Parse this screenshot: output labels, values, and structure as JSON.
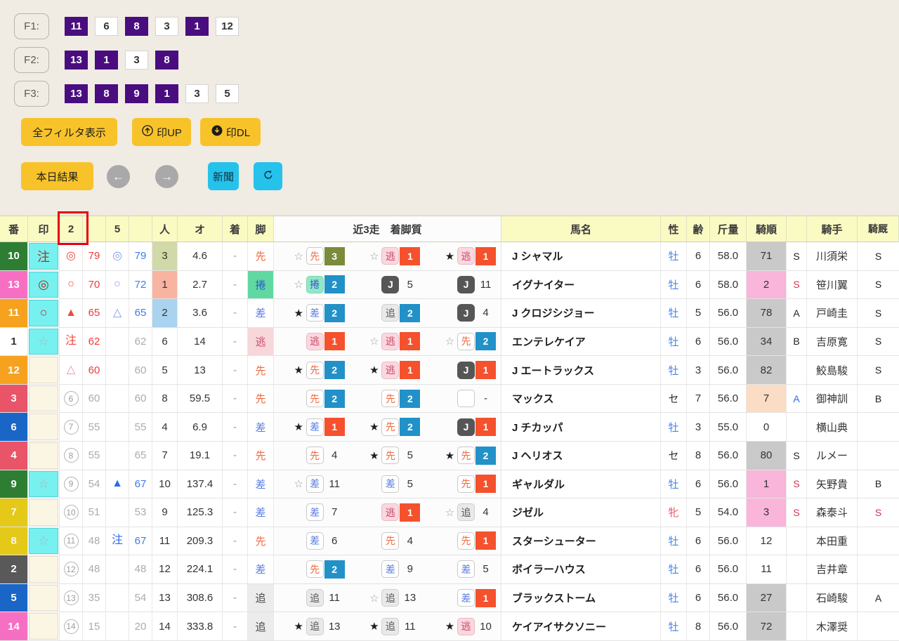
{
  "filters": {
    "rows": [
      {
        "label": "F1:",
        "chips": [
          {
            "v": "11",
            "on": true
          },
          {
            "v": "6",
            "on": false
          },
          {
            "v": "8",
            "on": true
          },
          {
            "v": "3",
            "on": false
          },
          {
            "v": "1",
            "on": true
          },
          {
            "v": "12",
            "on": false
          }
        ]
      },
      {
        "label": "F2:",
        "chips": [
          {
            "v": "13",
            "on": true
          },
          {
            "v": "1",
            "on": true
          },
          {
            "v": "3",
            "on": false
          },
          {
            "v": "8",
            "on": true
          }
        ]
      },
      {
        "label": "F3:",
        "chips": [
          {
            "v": "13",
            "on": true
          },
          {
            "v": "8",
            "on": true
          },
          {
            "v": "9",
            "on": true
          },
          {
            "v": "1",
            "on": true
          },
          {
            "v": "3",
            "on": false
          },
          {
            "v": "5",
            "on": false
          }
        ]
      }
    ]
  },
  "buttons": {
    "show_all_filters": "全フィルタ表示",
    "mark_up": "印UP",
    "mark_dl": "印DL",
    "today_results": "本日結果",
    "prev_arrow": "←",
    "next_arrow": "→",
    "newspaper": "新聞"
  },
  "icons": [
    "upload-icon",
    "download-icon",
    "left-arrow-icon",
    "right-arrow-icon",
    "refresh-icon"
  ],
  "colors": {
    "page_bg": "#f0ebe3",
    "chip_selected": "#490d80",
    "button_yellow": "#f8c32a",
    "button_cyan": "#25c2ec",
    "header_bg": "#fafac3",
    "annotation_red": "#e60012",
    "pos1": "#f4512c",
    "pos2": "#2191c8",
    "pos3": "#7a8b3a"
  },
  "annotation": {
    "target_header": "2",
    "color": "#e60012"
  },
  "table": {
    "headers": [
      "番",
      "印",
      "2",
      "",
      "5",
      "",
      "人",
      "オ",
      "着",
      "脚",
      "近3走　着脚質",
      "馬名",
      "性",
      "齢",
      "斤量",
      "騎順",
      "",
      "騎手",
      "騎厩"
    ],
    "rows": [
      {
        "num": "10",
        "waku": "w6",
        "mark": "注",
        "mark_cls": "mk-dr",
        "m1": "◎",
        "m1_cls": "sym-r",
        "m1_circ": false,
        "s1": "79",
        "s1_cls": "sc-r",
        "m2": "◎",
        "m2_cls": "sym-bl",
        "s2": "79",
        "s2_cls": "sc-b",
        "pop": "3",
        "pop_bg": "p3bg",
        "odds": "4.6",
        "fin": "-",
        "leg": "先",
        "leg_cls": "leg-sen",
        "runs": [
          {
            "star": "☆",
            "chip": "先",
            "chip_cls": "rc-sen",
            "pos": "3",
            "pos_cls": "pos-p3"
          },
          {
            "star": "☆",
            "chip": "逃",
            "chip_cls": "rc-nige",
            "pos": "1",
            "pos_cls": "pos-p1"
          },
          {
            "star": "★",
            "chip": "逃",
            "chip_cls": "rc-nige",
            "pos": "1",
            "pos_cls": "pos-p1"
          }
        ],
        "name": "J シャマル",
        "sex": "牡",
        "sex_cls": "sx-m",
        "age": "6",
        "wt": "58.0",
        "ord": "71",
        "ord_bg": "ord-gray",
        "sab": "S",
        "sab_cls": "t-k",
        "jockey": "川須栄",
        "kk": "S",
        "kk_cls": "t-k"
      },
      {
        "num": "13",
        "waku": "w8",
        "mark": "◎",
        "mark_cls": "mk-dr",
        "m1": "○",
        "m1_cls": "sym-r",
        "m1_circ": false,
        "s1": "70",
        "s1_cls": "sc-r",
        "m2": "○",
        "m2_cls": "sym-bl",
        "s2": "72",
        "s2_cls": "sc-b",
        "pop": "1",
        "pop_bg": "p1bg",
        "odds": "2.7",
        "fin": "-",
        "leg": "捲",
        "leg_cls": "leg-makuri",
        "runs": [
          {
            "star": "☆",
            "chip": "捲",
            "chip_cls": "rc-makuri",
            "pos": "2",
            "pos_cls": "pos-p2"
          },
          {
            "star": "",
            "chip": "J",
            "chip_cls": "rc-J",
            "pos": "5",
            "pos_cls": "pos-pn"
          },
          {
            "star": "",
            "chip": "J",
            "chip_cls": "rc-J",
            "pos": "11",
            "pos_cls": "pos-pn"
          }
        ],
        "name": "イグナイター",
        "sex": "牡",
        "sex_cls": "sx-m",
        "age": "6",
        "wt": "58.0",
        "ord": "2",
        "ord_bg": "ord-pink",
        "sab": "S",
        "sab_cls": "t-r",
        "jockey": "笹川翼",
        "kk": "S",
        "kk_cls": "t-k"
      },
      {
        "num": "11",
        "waku": "w7",
        "mark": "○",
        "mark_cls": "mk-dr",
        "m1": "▲",
        "m1_cls": "sym-r",
        "m1_circ": false,
        "s1": "65",
        "s1_cls": "sc-r",
        "m2": "△",
        "m2_cls": "sym-bl",
        "s2": "65",
        "s2_cls": "sc-b",
        "pop": "2",
        "pop_bg": "p2bg",
        "odds": "3.6",
        "fin": "-",
        "leg": "差",
        "leg_cls": "leg-sashi",
        "runs": [
          {
            "star": "★",
            "chip": "差",
            "chip_cls": "rc-sashi",
            "pos": "2",
            "pos_cls": "pos-p2"
          },
          {
            "star": "",
            "chip": "追",
            "chip_cls": "rc-oi",
            "pos": "2",
            "pos_cls": "pos-p2"
          },
          {
            "star": "",
            "chip": "J",
            "chip_cls": "rc-J",
            "pos": "4",
            "pos_cls": "pos-pn"
          }
        ],
        "name": "J クロジシジョー",
        "sex": "牡",
        "sex_cls": "sx-m",
        "age": "5",
        "wt": "56.0",
        "ord": "78",
        "ord_bg": "ord-gray",
        "sab": "A",
        "sab_cls": "t-k",
        "jockey": "戸崎圭",
        "kk": "S",
        "kk_cls": "t-k"
      },
      {
        "num": "1",
        "waku": "w1",
        "mark": "☆",
        "mark_cls": "mk-gs",
        "m1": "注",
        "m1_cls": "sym-r",
        "m1_circ": false,
        "s1": "62",
        "s1_cls": "sc-r",
        "m2": "",
        "m2_cls": "",
        "s2": "62",
        "s2_cls": "sc-g",
        "pop": "6",
        "pop_bg": "",
        "odds": "14",
        "fin": "-",
        "leg": "逃",
        "leg_cls": "leg-nige",
        "runs": [
          {
            "star": "",
            "chip": "逃",
            "chip_cls": "rc-nige",
            "pos": "1",
            "pos_cls": "pos-p1"
          },
          {
            "star": "☆",
            "chip": "逃",
            "chip_cls": "rc-nige",
            "pos": "1",
            "pos_cls": "pos-p1"
          },
          {
            "star": "☆",
            "chip": "先",
            "chip_cls": "rc-sen",
            "pos": "2",
            "pos_cls": "pos-p2"
          }
        ],
        "name": "エンテレケイア",
        "sex": "牡",
        "sex_cls": "sx-m",
        "age": "6",
        "wt": "56.0",
        "ord": "34",
        "ord_bg": "ord-gray",
        "sab": "B",
        "sab_cls": "t-k",
        "jockey": "吉原寛",
        "kk": "S",
        "kk_cls": "t-k"
      },
      {
        "num": "12",
        "waku": "w7",
        "mark": "",
        "mark_cls": "",
        "m1": "△",
        "m1_cls": "sym-pk",
        "m1_circ": false,
        "s1": "60",
        "s1_cls": "sc-r",
        "m2": "",
        "m2_cls": "",
        "s2": "60",
        "s2_cls": "sc-g",
        "pop": "5",
        "pop_bg": "",
        "odds": "13",
        "fin": "-",
        "leg": "先",
        "leg_cls": "leg-sen",
        "runs": [
          {
            "star": "★",
            "chip": "先",
            "chip_cls": "rc-sen",
            "pos": "2",
            "pos_cls": "pos-p2"
          },
          {
            "star": "★",
            "chip": "逃",
            "chip_cls": "rc-nige",
            "pos": "1",
            "pos_cls": "pos-p1"
          },
          {
            "star": "",
            "chip": "J",
            "chip_cls": "rc-J",
            "pos": "1",
            "pos_cls": "pos-p1"
          }
        ],
        "name": "J エートラックス",
        "sex": "牡",
        "sex_cls": "sx-m",
        "age": "3",
        "wt": "56.0",
        "ord": "82",
        "ord_bg": "ord-gray",
        "sab": "",
        "sab_cls": "",
        "jockey": "鮫島駿",
        "kk": "S",
        "kk_cls": "t-k"
      },
      {
        "num": "3",
        "waku": "w3",
        "mark": "",
        "mark_cls": "",
        "m1": "6",
        "m1_cls": "",
        "m1_circ": true,
        "s1": "60",
        "s1_cls": "sc-g",
        "m2": "",
        "m2_cls": "",
        "s2": "60",
        "s2_cls": "sc-g",
        "pop": "8",
        "pop_bg": "",
        "odds": "59.5",
        "fin": "-",
        "leg": "先",
        "leg_cls": "leg-sen",
        "runs": [
          {
            "star": "",
            "chip": "先",
            "chip_cls": "rc-sen",
            "pos": "2",
            "pos_cls": "pos-p2"
          },
          {
            "star": "",
            "chip": "先",
            "chip_cls": "rc-sen",
            "pos": "2",
            "pos_cls": "pos-p2"
          },
          {
            "star": "",
            "chip": "",
            "chip_cls": "rc-empty",
            "pos": "-",
            "pos_cls": "pos-pn"
          }
        ],
        "name": "マックス",
        "sex": "セ",
        "sex_cls": "sx-g",
        "age": "7",
        "wt": "56.0",
        "ord": "7",
        "ord_bg": "ord-peach",
        "sab": "A",
        "sab_cls": "t-b",
        "jockey": "御神訓",
        "kk": "B",
        "kk_cls": "t-k"
      },
      {
        "num": "6",
        "waku": "w4",
        "mark": "",
        "mark_cls": "",
        "m1": "7",
        "m1_cls": "",
        "m1_circ": true,
        "s1": "55",
        "s1_cls": "sc-g",
        "m2": "",
        "m2_cls": "",
        "s2": "55",
        "s2_cls": "sc-g",
        "pop": "4",
        "pop_bg": "",
        "odds": "6.9",
        "fin": "-",
        "leg": "差",
        "leg_cls": "leg-sashi",
        "runs": [
          {
            "star": "★",
            "chip": "差",
            "chip_cls": "rc-sashi",
            "pos": "1",
            "pos_cls": "pos-p1"
          },
          {
            "star": "★",
            "chip": "先",
            "chip_cls": "rc-sen",
            "pos": "2",
            "pos_cls": "pos-p2"
          },
          {
            "star": "",
            "chip": "J",
            "chip_cls": "rc-J",
            "pos": "1",
            "pos_cls": "pos-p1"
          }
        ],
        "name": "J チカッパ",
        "sex": "牡",
        "sex_cls": "sx-m",
        "age": "3",
        "wt": "55.0",
        "ord": "0",
        "ord_bg": "",
        "sab": "",
        "sab_cls": "",
        "jockey": "横山典",
        "kk": "",
        "kk_cls": ""
      },
      {
        "num": "4",
        "waku": "w3",
        "mark": "",
        "mark_cls": "",
        "m1": "8",
        "m1_cls": "",
        "m1_circ": true,
        "s1": "55",
        "s1_cls": "sc-g",
        "m2": "",
        "m2_cls": "",
        "s2": "65",
        "s2_cls": "sc-g",
        "pop": "7",
        "pop_bg": "",
        "odds": "19.1",
        "fin": "-",
        "leg": "先",
        "leg_cls": "leg-sen",
        "runs": [
          {
            "star": "",
            "chip": "先",
            "chip_cls": "rc-sen",
            "pos": "4",
            "pos_cls": "pos-pn"
          },
          {
            "star": "★",
            "chip": "先",
            "chip_cls": "rc-sen",
            "pos": "5",
            "pos_cls": "pos-pn"
          },
          {
            "star": "★",
            "chip": "先",
            "chip_cls": "rc-sen",
            "pos": "2",
            "pos_cls": "pos-p2"
          }
        ],
        "name": "J ヘリオス",
        "sex": "セ",
        "sex_cls": "sx-g",
        "age": "8",
        "wt": "56.0",
        "ord": "80",
        "ord_bg": "ord-gray",
        "sab": "S",
        "sab_cls": "t-k",
        "jockey": "ルメー",
        "kk": "",
        "kk_cls": ""
      },
      {
        "num": "9",
        "waku": "w6",
        "mark": "☆",
        "mark_cls": "mk-gs",
        "m1": "9",
        "m1_cls": "",
        "m1_circ": true,
        "s1": "54",
        "s1_cls": "sc-g",
        "m2": "▲",
        "m2_cls": "sym-b",
        "s2": "67",
        "s2_cls": "sc-b",
        "pop": "10",
        "pop_bg": "",
        "odds": "137.4",
        "fin": "-",
        "leg": "差",
        "leg_cls": "leg-sashi",
        "runs": [
          {
            "star": "☆",
            "chip": "差",
            "chip_cls": "rc-sashi",
            "pos": "11",
            "pos_cls": "pos-pn"
          },
          {
            "star": "",
            "chip": "差",
            "chip_cls": "rc-sashi",
            "pos": "5",
            "pos_cls": "pos-pn"
          },
          {
            "star": "",
            "chip": "先",
            "chip_cls": "rc-sen",
            "pos": "1",
            "pos_cls": "pos-p1"
          }
        ],
        "name": "ギャルダル",
        "sex": "牡",
        "sex_cls": "sx-m",
        "age": "6",
        "wt": "56.0",
        "ord": "1",
        "ord_bg": "ord-pink",
        "sab": "S",
        "sab_cls": "t-r",
        "jockey": "矢野貴",
        "kk": "B",
        "kk_cls": "t-k"
      },
      {
        "num": "7",
        "waku": "w5",
        "mark": "",
        "mark_cls": "",
        "m1": "10",
        "m1_cls": "",
        "m1_circ": true,
        "s1": "51",
        "s1_cls": "sc-g",
        "m2": "",
        "m2_cls": "",
        "s2": "53",
        "s2_cls": "sc-g",
        "pop": "9",
        "pop_bg": "",
        "odds": "125.3",
        "fin": "-",
        "leg": "差",
        "leg_cls": "leg-sashi",
        "runs": [
          {
            "star": "",
            "chip": "差",
            "chip_cls": "rc-sashi",
            "pos": "7",
            "pos_cls": "pos-pn"
          },
          {
            "star": "",
            "chip": "逃",
            "chip_cls": "rc-nige",
            "pos": "1",
            "pos_cls": "pos-p1"
          },
          {
            "star": "☆",
            "chip": "追",
            "chip_cls": "rc-oi",
            "pos": "4",
            "pos_cls": "pos-pn"
          }
        ],
        "name": "ジゼル",
        "sex": "牝",
        "sex_cls": "sx-f",
        "age": "5",
        "wt": "54.0",
        "ord": "3",
        "ord_bg": "ord-pink",
        "sab": "S",
        "sab_cls": "t-r",
        "jockey": "森泰斗",
        "kk": "S",
        "kk_cls": "t-r"
      },
      {
        "num": "8",
        "waku": "w5",
        "mark": "☆",
        "mark_cls": "mk-gs",
        "m1": "11",
        "m1_cls": "",
        "m1_circ": true,
        "s1": "48",
        "s1_cls": "sc-g",
        "m2": "注",
        "m2_cls": "sym-b",
        "s2": "67",
        "s2_cls": "sc-b",
        "pop": "11",
        "pop_bg": "",
        "odds": "209.3",
        "fin": "-",
        "leg": "先",
        "leg_cls": "leg-sen",
        "runs": [
          {
            "star": "",
            "chip": "差",
            "chip_cls": "rc-sashi",
            "pos": "6",
            "pos_cls": "pos-pn"
          },
          {
            "star": "",
            "chip": "先",
            "chip_cls": "rc-sen",
            "pos": "4",
            "pos_cls": "pos-pn"
          },
          {
            "star": "",
            "chip": "先",
            "chip_cls": "rc-sen",
            "pos": "1",
            "pos_cls": "pos-p1"
          }
        ],
        "name": "スターシューター",
        "sex": "牡",
        "sex_cls": "sx-m",
        "age": "6",
        "wt": "56.0",
        "ord": "12",
        "ord_bg": "",
        "sab": "",
        "sab_cls": "",
        "jockey": "本田重",
        "kk": "",
        "kk_cls": ""
      },
      {
        "num": "2",
        "waku": "w2",
        "mark": "",
        "mark_cls": "",
        "m1": "12",
        "m1_cls": "",
        "m1_circ": true,
        "s1": "48",
        "s1_cls": "sc-g",
        "m2": "",
        "m2_cls": "",
        "s2": "48",
        "s2_cls": "sc-g",
        "pop": "12",
        "pop_bg": "",
        "odds": "224.1",
        "fin": "-",
        "leg": "差",
        "leg_cls": "leg-sashi",
        "runs": [
          {
            "star": "",
            "chip": "先",
            "chip_cls": "rc-sen",
            "pos": "2",
            "pos_cls": "pos-p2"
          },
          {
            "star": "",
            "chip": "差",
            "chip_cls": "rc-sashi",
            "pos": "9",
            "pos_cls": "pos-pn"
          },
          {
            "star": "",
            "chip": "差",
            "chip_cls": "rc-sashi",
            "pos": "5",
            "pos_cls": "pos-pn"
          }
        ],
        "name": "ボイラーハウス",
        "sex": "牡",
        "sex_cls": "sx-m",
        "age": "6",
        "wt": "56.0",
        "ord": "11",
        "ord_bg": "",
        "sab": "",
        "sab_cls": "",
        "jockey": "吉井章",
        "kk": "",
        "kk_cls": ""
      },
      {
        "num": "5",
        "waku": "w4",
        "mark": "",
        "mark_cls": "",
        "m1": "13",
        "m1_cls": "",
        "m1_circ": true,
        "s1": "35",
        "s1_cls": "sc-g",
        "m2": "",
        "m2_cls": "",
        "s2": "54",
        "s2_cls": "sc-g",
        "pop": "13",
        "pop_bg": "",
        "odds": "308.6",
        "fin": "-",
        "leg": "追",
        "leg_cls": "leg-oi",
        "runs": [
          {
            "star": "",
            "chip": "追",
            "chip_cls": "rc-oi",
            "pos": "11",
            "pos_cls": "pos-pn"
          },
          {
            "star": "☆",
            "chip": "追",
            "chip_cls": "rc-oi",
            "pos": "13",
            "pos_cls": "pos-pn"
          },
          {
            "star": "",
            "chip": "差",
            "chip_cls": "rc-sashi",
            "pos": "1",
            "pos_cls": "pos-p1"
          }
        ],
        "name": "ブラックストーム",
        "sex": "牡",
        "sex_cls": "sx-m",
        "age": "6",
        "wt": "56.0",
        "ord": "27",
        "ord_bg": "ord-gray",
        "sab": "",
        "sab_cls": "",
        "jockey": "石崎駿",
        "kk": "A",
        "kk_cls": "t-k"
      },
      {
        "num": "14",
        "waku": "w8",
        "mark": "",
        "mark_cls": "",
        "m1": "14",
        "m1_cls": "",
        "m1_circ": true,
        "s1": "15",
        "s1_cls": "sc-g",
        "m2": "",
        "m2_cls": "",
        "s2": "20",
        "s2_cls": "sc-g",
        "pop": "14",
        "pop_bg": "",
        "odds": "333.8",
        "fin": "-",
        "leg": "追",
        "leg_cls": "leg-oi",
        "runs": [
          {
            "star": "★",
            "chip": "追",
            "chip_cls": "rc-oi",
            "pos": "13",
            "pos_cls": "pos-pn"
          },
          {
            "star": "★",
            "chip": "追",
            "chip_cls": "rc-oi",
            "pos": "11",
            "pos_cls": "pos-pn"
          },
          {
            "star": "★",
            "chip": "逃",
            "chip_cls": "rc-nige",
            "pos": "10",
            "pos_cls": "pos-pn"
          }
        ],
        "name": "ケイアイサクソニー",
        "sex": "牡",
        "sex_cls": "sx-m",
        "age": "8",
        "wt": "56.0",
        "ord": "72",
        "ord_bg": "ord-gray",
        "sab": "",
        "sab_cls": "",
        "jockey": "木澤奨",
        "kk": "",
        "kk_cls": ""
      }
    ]
  }
}
